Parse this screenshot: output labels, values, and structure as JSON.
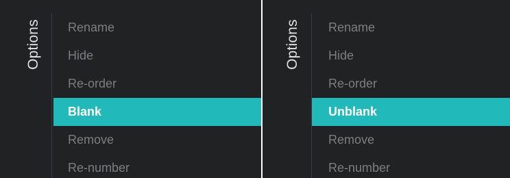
{
  "screens": [
    {
      "title": "Options",
      "selected_index": 3,
      "items": [
        {
          "label": "Rename"
        },
        {
          "label": "Hide"
        },
        {
          "label": "Re-order"
        },
        {
          "label": "Blank"
        },
        {
          "label": "Remove"
        },
        {
          "label": "Re-number"
        }
      ]
    },
    {
      "title": "Options",
      "selected_index": 3,
      "items": [
        {
          "label": "Rename"
        },
        {
          "label": "Hide"
        },
        {
          "label": "Re-order"
        },
        {
          "label": "Unblank"
        },
        {
          "label": "Remove"
        },
        {
          "label": "Re-number"
        }
      ]
    }
  ],
  "colors": {
    "background": "#212224",
    "highlight": "#21b9b9",
    "item_text": "#7d7e80",
    "selected_text": "#ffffff",
    "title_text": "#e2e2e2"
  }
}
